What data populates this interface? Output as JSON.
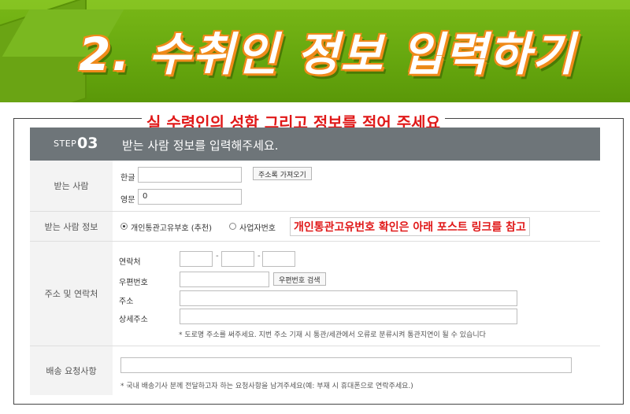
{
  "banner": {
    "title": "2. 수취인 정보 입력하기"
  },
  "annotations": {
    "title": "실 수령인의 성함 그리고 정보를 적어 주세요",
    "note": "개인통관고유번호 확인은 아래 포스트 링크를 참고"
  },
  "step": {
    "label": "STEP",
    "number": "03",
    "title": "받는 사람 정보를 입력해주세요."
  },
  "recipient": {
    "row_label": "받는 사람",
    "korean_label": "한글",
    "korean_value": "",
    "address_book_button": "주소록 가져오기",
    "english_label": "영문",
    "english_value": "0"
  },
  "recipient_info": {
    "row_label": "받는 사람 정보",
    "options": [
      "개인통관고유부호 (추천)",
      "사업자번호"
    ],
    "selected": "개인통관고유부호 (추천)"
  },
  "contact": {
    "row_label": "주소 및 연락처",
    "phone_label": "연락처",
    "phone_sep": "-",
    "phone": [
      "",
      "",
      ""
    ],
    "zipcode_label": "우편번호",
    "zipcode_value": "",
    "zipcode_button": "우편번호 검색",
    "address_label": "주소",
    "address_value": "",
    "detail_label": "상세주소",
    "detail_value": "",
    "hint": "* 도로명 주소를 써주세요. 지번 주소 기재 시 통관/세관에서 오류로 분류시켜 통관지연이 될 수 있습니다"
  },
  "delivery": {
    "row_label": "배송 요청사항",
    "value": "",
    "hint": "* 국내 배송기사 분께 전달하고자 하는 요청사항을 남겨주세요(예: 부재 시 휴대폰으로 연락주세요.)"
  },
  "colors": {
    "banner_green": "#6aab12",
    "title_outline": "#f08a1a",
    "step_bar": "#6e7579",
    "annotation_red": "#e01818"
  }
}
